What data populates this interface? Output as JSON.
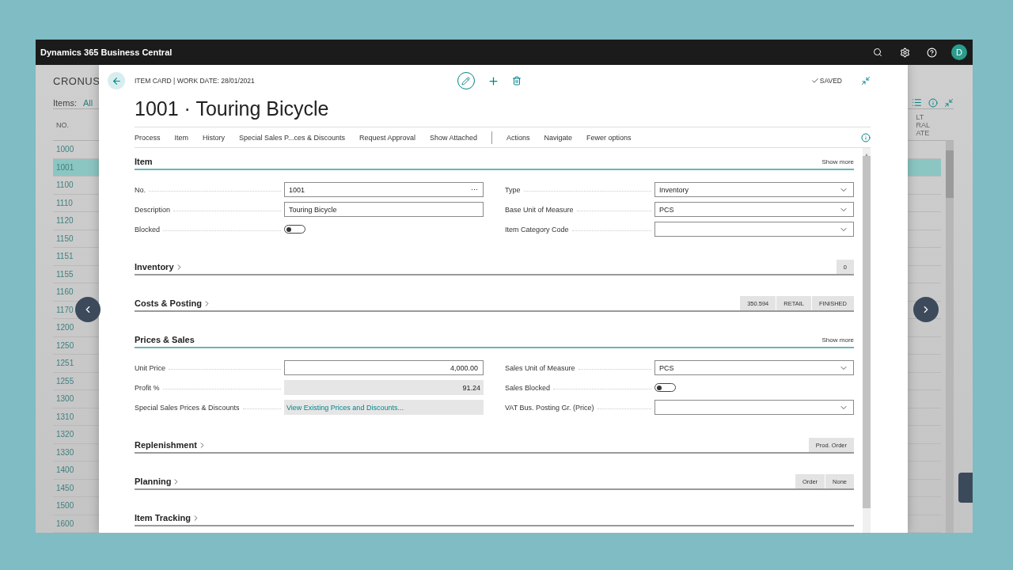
{
  "app": {
    "title": "Dynamics 365 Business Central",
    "avatar": "D"
  },
  "list_page": {
    "company": "CRONUS",
    "filter_label": "Items:",
    "filter_value": "All",
    "column_1": "NO.",
    "column_2_lines": [
      "LT",
      "RAL",
      "ATE"
    ],
    "rows": [
      {
        "no": "1000",
        "selected": false
      },
      {
        "no": "1001",
        "selected": true
      },
      {
        "no": "1100",
        "selected": false
      },
      {
        "no": "1110",
        "selected": false
      },
      {
        "no": "1120",
        "selected": false
      },
      {
        "no": "1150",
        "selected": false
      },
      {
        "no": "1151",
        "selected": false
      },
      {
        "no": "1155",
        "selected": false
      },
      {
        "no": "1160",
        "selected": false
      },
      {
        "no": "1170",
        "selected": false
      },
      {
        "no": "1200",
        "selected": false
      },
      {
        "no": "1250",
        "selected": false
      },
      {
        "no": "1251",
        "selected": false
      },
      {
        "no": "1255",
        "selected": false
      },
      {
        "no": "1300",
        "selected": false
      },
      {
        "no": "1310",
        "selected": false
      },
      {
        "no": "1320",
        "selected": false
      },
      {
        "no": "1330",
        "selected": false
      },
      {
        "no": "1400",
        "selected": false
      },
      {
        "no": "1450",
        "selected": false
      },
      {
        "no": "1500",
        "selected": false
      },
      {
        "no": "1600",
        "selected": false
      }
    ]
  },
  "card": {
    "breadcrumb": "ITEM CARD | WORK DATE: 28/01/2021",
    "status": "SAVED",
    "title": "1001 · Touring Bicycle",
    "promoted_actions": [
      "Process",
      "Item",
      "History",
      "Special Sales P...ces & Discounts",
      "Request Approval",
      "Show Attached"
    ],
    "menu_actions": [
      "Actions",
      "Navigate",
      "Fewer options"
    ],
    "sections": [
      {
        "title": "Item",
        "expanded": true,
        "show_more": "Show more",
        "fields_left": [
          {
            "label": "No.",
            "kind": "text",
            "value": "1001",
            "lookup_glyph": "⋯"
          },
          {
            "label": "Description",
            "kind": "text",
            "value": "Touring Bicycle"
          },
          {
            "label": "Blocked",
            "kind": "toggle",
            "on": false
          }
        ],
        "fields_right": [
          {
            "label": "Type",
            "kind": "select",
            "value": "Inventory"
          },
          {
            "label": "Base Unit of Measure",
            "kind": "select",
            "value": "PCS"
          },
          {
            "label": "Item Category Code",
            "kind": "select"
          }
        ]
      },
      {
        "title": "Inventory",
        "expanded": false,
        "badges": [
          "0"
        ]
      },
      {
        "title": "Costs & Posting",
        "expanded": false,
        "badges": [
          "350.594",
          "RETAIL",
          "FINISHED"
        ]
      },
      {
        "title": "Prices & Sales",
        "expanded": true,
        "show_more": "Show more",
        "fields_left": [
          {
            "label": "Unit Price",
            "kind": "number",
            "value": "4,000.00"
          },
          {
            "label": "Profit %",
            "kind": "readonly",
            "value": "91.24"
          },
          {
            "label": "Special Sales Prices & Discounts",
            "kind": "link",
            "value": "View Existing Prices and Discounts..."
          }
        ],
        "fields_right": [
          {
            "label": "Sales Unit of Measure",
            "kind": "select",
            "value": "PCS"
          },
          {
            "label": "Sales Blocked",
            "kind": "toggle",
            "on": false
          },
          {
            "label": "VAT Bus. Posting Gr. (Price)",
            "kind": "select"
          }
        ]
      },
      {
        "title": "Replenishment",
        "expanded": false,
        "badges": [
          "Prod. Order"
        ]
      },
      {
        "title": "Planning",
        "expanded": false,
        "badges": [
          "Order",
          "None"
        ]
      },
      {
        "title": "Item Tracking",
        "expanded": false
      }
    ]
  }
}
